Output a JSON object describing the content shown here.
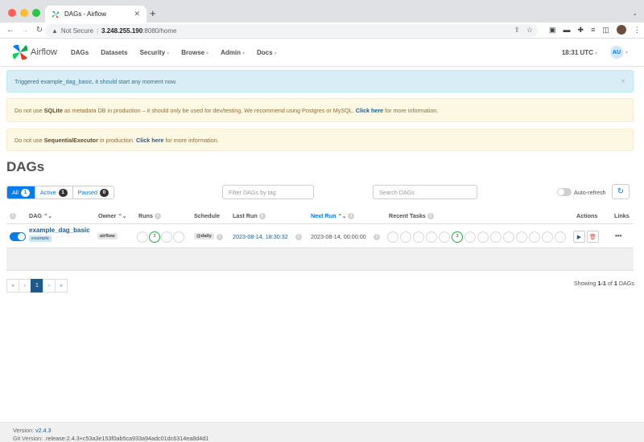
{
  "browser": {
    "tab_title": "DAGs - Airflow",
    "not_secure": "Not Secure",
    "url_host": "3.248.255.190",
    "url_path": ":8080/home"
  },
  "navbar": {
    "brand": "Airflow",
    "items": [
      "DAGs",
      "Datasets",
      "Security",
      "Browse",
      "Admin",
      "Docs"
    ],
    "time": "18:31 UTC",
    "user_initials": "AU"
  },
  "alerts": {
    "info": "Triggered example_dag_basic, it should start any moment now.",
    "sqlite": {
      "pre": "Do not use ",
      "bold": "SQLite",
      "mid": " as metadata DB in production – it should only be used for dev/testing. We recommend using Postgres or MySQL. ",
      "link": "Click here",
      "post": " for more information."
    },
    "executor": {
      "pre": "Do not use ",
      "bold": "SequentialExecutor",
      "mid": " in production. ",
      "link": "Click here",
      "post": " for more information."
    }
  },
  "page": {
    "title": "DAGs",
    "filters": {
      "all_label": "All",
      "all_count": "1",
      "active_label": "Active",
      "active_count": "1",
      "paused_label": "Paused",
      "paused_count": "0"
    },
    "tag_placeholder": "Filter DAGs by tag",
    "search_placeholder": "Search DAGs",
    "auto_refresh": "Auto-refresh"
  },
  "table": {
    "headers": {
      "dag": "DAG",
      "owner": "Owner",
      "runs": "Runs",
      "schedule": "Schedule",
      "last_run": "Last Run",
      "next_run": "Next Run",
      "recent_tasks": "Recent Tasks",
      "actions": "Actions",
      "links": "Links"
    },
    "rows": [
      {
        "dag_id": "example_dag_basic",
        "tag": "example",
        "owner": "airflow",
        "running_runs": "2",
        "schedule": "@daily",
        "last_run": "2023-08-14, 18:30:32",
        "next_run": "2023-08-14, 00:00:00",
        "running_tasks": "3",
        "links": "•••"
      }
    ]
  },
  "pagination": {
    "first": "«",
    "prev": "‹",
    "current": "1",
    "next": "›",
    "last": "»",
    "showing_pre": "Showing ",
    "showing_range": "1-1",
    "showing_mid": " of ",
    "showing_total": "1",
    "showing_post": " DAGs"
  },
  "footer": {
    "version_label": "Version: ",
    "version": "v2.4.3",
    "git_label": "Git Version: ",
    "git": ".release:2.4.3+c53a3e153f0ab5ca933a94adc01dc6314ea8d4d1"
  },
  "colors": {
    "accent": "#017cee",
    "link": "#1e5a8c",
    "running": "#28a745",
    "info_bg": "#d9edf7",
    "warn_bg": "#fcf8e3"
  }
}
